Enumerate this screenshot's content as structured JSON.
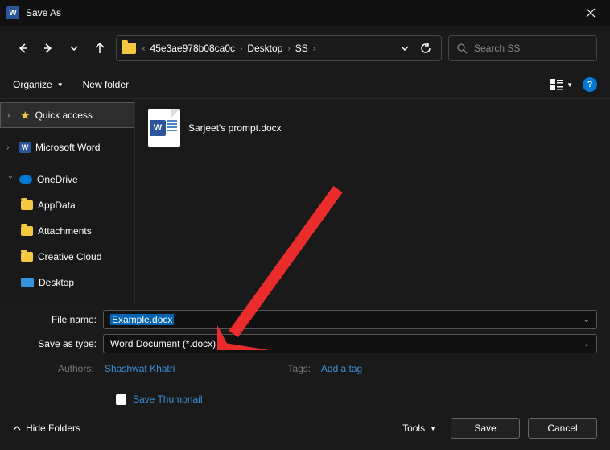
{
  "titlebar": {
    "title": "Save As"
  },
  "breadcrumbs": {
    "doubleArrow": "«",
    "items": [
      "45e3ae978b08ca0c",
      "Desktop",
      "SS"
    ]
  },
  "search": {
    "placeholder": "Search SS"
  },
  "toolbar": {
    "organize": "Organize",
    "newFolder": "New folder"
  },
  "nav": {
    "quickAccess": "Quick access",
    "word": "Microsoft Word",
    "onedrive": "OneDrive",
    "children": [
      "AppData",
      "Attachments",
      "Creative Cloud",
      "Desktop"
    ]
  },
  "file": {
    "name": "Sarjeet's prompt.docx"
  },
  "form": {
    "fileNameLabel": "File name:",
    "fileNameValue": "Example.docx",
    "saveAsTypeLabel": "Save as type:",
    "saveAsTypeValue": "Word Document (*.docx)",
    "authorsLabel": "Authors:",
    "authorsValue": "Shashwat Khatri",
    "tagsLabel": "Tags:",
    "tagsValue": "Add a tag",
    "saveThumbnail": "Save Thumbnail"
  },
  "footer": {
    "hideFolders": "Hide Folders",
    "tools": "Tools",
    "save": "Save",
    "cancel": "Cancel"
  }
}
